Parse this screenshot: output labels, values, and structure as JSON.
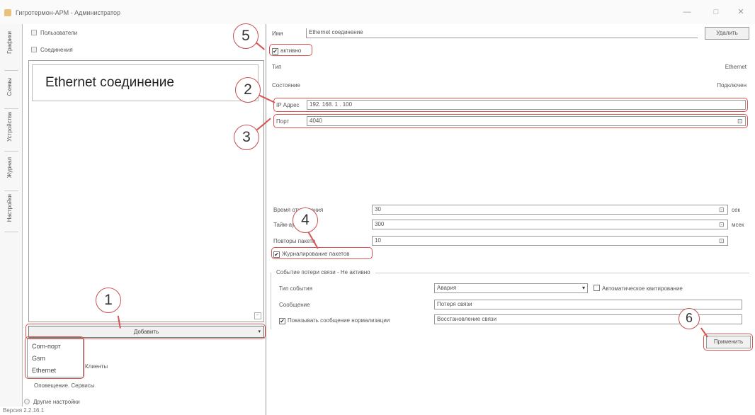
{
  "window": {
    "title": "Гигротермон-АРМ - Администратор",
    "controls": [
      "—",
      "□",
      "✕"
    ]
  },
  "side_tabs": [
    "Графики",
    "Схемы",
    "Устройства",
    "Журнал",
    "Настройки"
  ],
  "tree": {
    "users": "Пользователи",
    "connections": "Соединения"
  },
  "connection_list": {
    "items": [
      "Ethernet соединение"
    ],
    "scroll_glyph": "⌐"
  },
  "add_combo": {
    "label": "Добавить",
    "arrow": "▾",
    "options": [
      "Com-порт",
      "Gsm",
      "Ethernet"
    ]
  },
  "bottom_nav": {
    "clients": "Клиенты",
    "notify_services": "Оповещение. Сервисы",
    "other_settings": "Другие настройки"
  },
  "version": "Версия 2.2.16.1",
  "form": {
    "name_label": "Имя",
    "name_value": "Ethernet соединение",
    "delete_button": "Удалить",
    "active_label": "активно",
    "active_checked": true,
    "type_label": "Тип",
    "type_value": "Ethernet",
    "state_label": "Состояние",
    "state_value": "Подключен",
    "ip_label": "IP Адрес",
    "ip_value": "192. 168. 1 . 100",
    "port_label": "Порт",
    "port_value": "4040",
    "spin_glyph": "⊡",
    "disconnect_label": "Время отключения",
    "disconnect_value": "30",
    "disconnect_unit": "сек",
    "timeout_label": "Тайм-аут",
    "timeout_value": "300",
    "timeout_unit": "мсек",
    "retries_label": "Повторы пакета",
    "retries_value": "10",
    "packet_logging_label": "Журналирование пакетов",
    "packet_logging_checked": true
  },
  "link_loss": {
    "group_title": "Событие потери связи - Не активно",
    "event_type_label": "Тип события",
    "event_type_value": "Авария",
    "combo_arrow": "▾",
    "auto_ack_label": "Автоматическое квитирование",
    "auto_ack_checked": false,
    "message_label": "Сообщение",
    "message_value": "Потеря связи",
    "show_norm_label": "Показывать сообщение нормализации",
    "show_norm_checked": true,
    "norm_value": "Восстановление связи"
  },
  "apply_button": "Применить",
  "callouts": [
    "1",
    "2",
    "3",
    "4",
    "5",
    "6"
  ],
  "colors": {
    "highlight": "#d9534f",
    "callout_border": "#c85050",
    "panel_border": "#9a9a9a",
    "text": "#444444"
  }
}
